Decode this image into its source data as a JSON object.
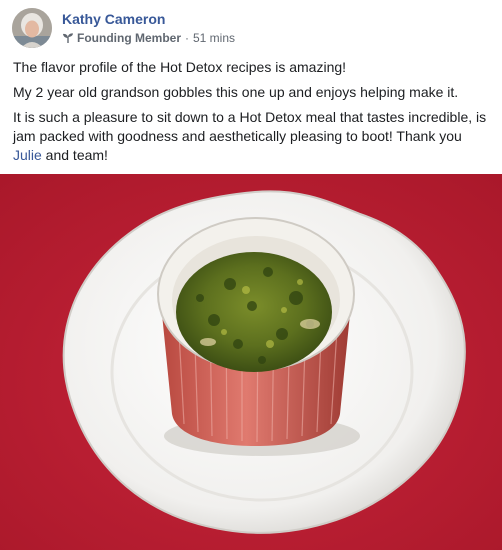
{
  "post": {
    "author": "Kathy Cameron",
    "role": "Founding Member",
    "separator": "·",
    "timestamp": "51 mins",
    "badge_icon": "sprout-icon",
    "paragraphs": {
      "p1": "The flavor profile of the Hot Detox recipes is amazing!",
      "p2": "My 2 year old grandson gobbles this one up and enjoys helping make it.",
      "p3_before": "It is such a pleasure to sit down to a Hot Detox meal that tastes incredible, is jam packed with goodness and aesthetically pleasing to boot! Thank you ",
      "p3_mention": "Julie",
      "p3_after": " and team!"
    },
    "photo_subject": "baked egg and greens in a red ramekin on a white plate"
  },
  "colors": {
    "link": "#385898",
    "text": "#1c1e21",
    "meta": "#606770",
    "tablecloth": "#c01f30"
  }
}
